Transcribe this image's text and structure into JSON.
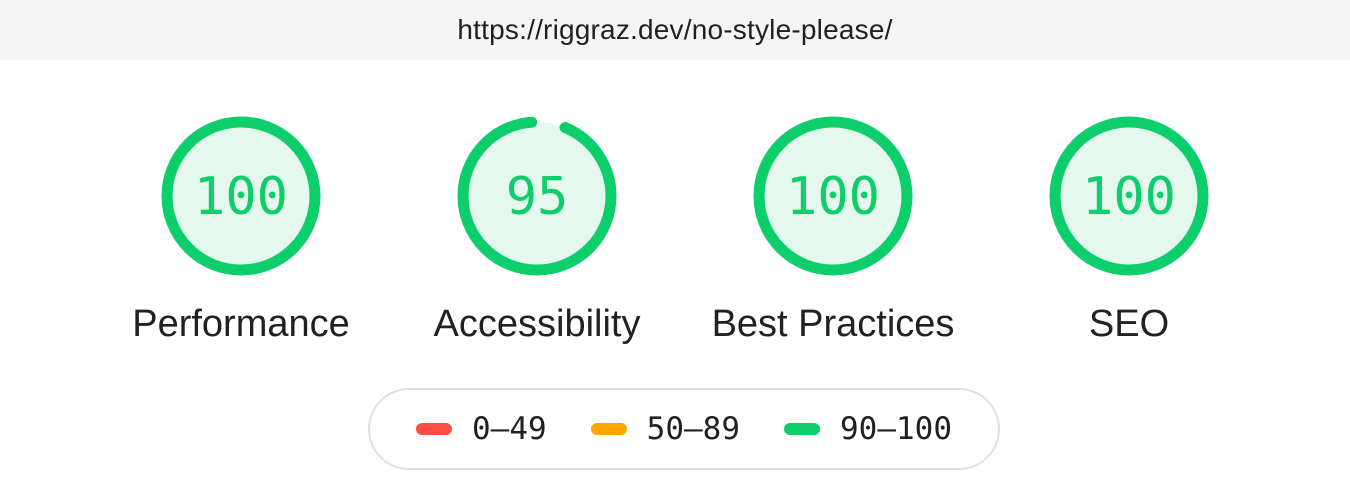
{
  "header": {
    "url": "https://riggraz.dev/no-style-please/"
  },
  "gauges": [
    {
      "score": "100",
      "label": "Performance",
      "value": 100
    },
    {
      "score": "95",
      "label": "Accessibility",
      "value": 95
    },
    {
      "score": "100",
      "label": "Best Practices",
      "value": 100
    },
    {
      "score": "100",
      "label": "SEO",
      "value": 100
    }
  ],
  "legend": [
    {
      "range": "0–49",
      "color": "#ff4e42"
    },
    {
      "range": "50–89",
      "color": "#ffa400"
    },
    {
      "range": "90–100",
      "color": "#0cce6b"
    }
  ],
  "colors": {
    "pass": "#0cce6b",
    "pass_fill": "#e5f8ee"
  }
}
